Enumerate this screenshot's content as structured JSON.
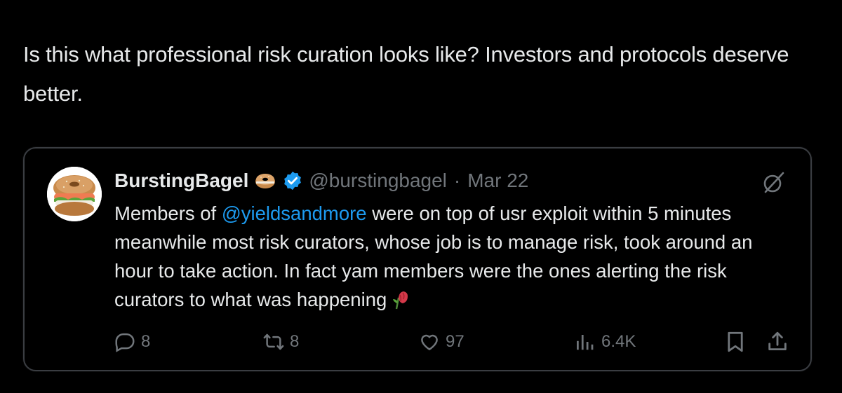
{
  "post": {
    "text": "Is this what professional risk curation looks like? Investors and protocols deserve better."
  },
  "quoted_tweet": {
    "display_name": "BurstingBagel",
    "handle": "@burstingbagel",
    "separator": "·",
    "date": "Mar 22",
    "body_prefix": "Members of ",
    "mention": "@yieldsandmore",
    "body_suffix": " were on top of usr exploit within 5 minutes meanwhile most risk curators, whose job is to manage risk, took around an hour to take action. In fact yam members were the ones alerting the risk curators to what was happening",
    "stats": {
      "replies": "8",
      "reposts": "8",
      "likes": "97",
      "views": "6.4K"
    },
    "icons": {
      "name_emoji": "bagel-emoji-icon",
      "verified": "verified-badge-icon",
      "top_right": "grok-icon",
      "end_emoji": "wilted-rose-emoji-icon",
      "reply": "reply-icon",
      "repost": "repost-icon",
      "like": "heart-icon",
      "views": "views-chart-icon",
      "bookmark": "bookmark-icon",
      "share": "share-icon"
    },
    "colors": {
      "accent": "#1d9bf0",
      "muted": "#71767b",
      "text": "#e7e9ea",
      "border": "#3a3d42"
    }
  }
}
